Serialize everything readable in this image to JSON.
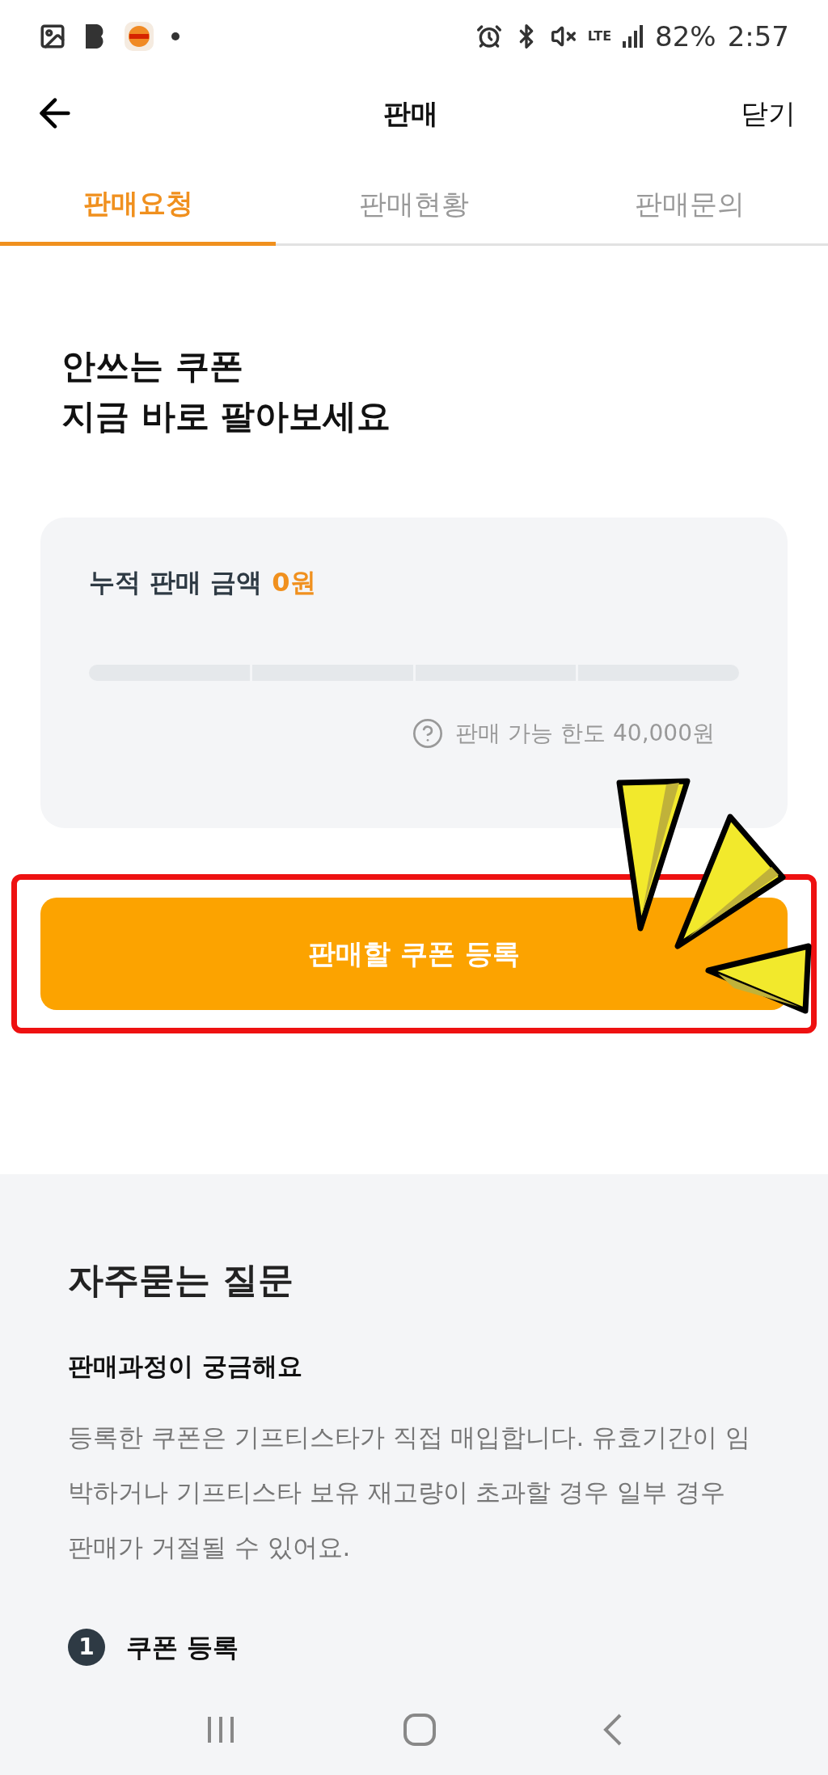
{
  "status_bar": {
    "time": "2:57",
    "battery": "82%",
    "network": "LTE"
  },
  "header": {
    "title": "판매",
    "close": "닫기"
  },
  "tabs": [
    {
      "label": "판매요청",
      "selected": true
    },
    {
      "label": "판매현황",
      "selected": false
    },
    {
      "label": "판매문의",
      "selected": false
    }
  ],
  "headline": [
    "안쓰는 쿠폰",
    "지금 바로 팔아보세요"
  ],
  "summary_card": {
    "label": "누적 판매 금액",
    "amount": "0원",
    "limit": "판매 가능 한도 40,000원"
  },
  "register_button": {
    "label": "판매할 쿠폰 등록",
    "highlighted": true
  },
  "faq": {
    "title": "자주묻는 질문",
    "question": "판매과정이 궁금해요",
    "answer": "등록한 쿠폰은 기프티스타가 직접 매입합니다. 유효기간이 임박하거나 기프티스타 보유 재고량이 초과할 경우 일부 경우 판매가 거절될 수 있어요.",
    "steps": [
      {
        "number": "1",
        "label": "쿠폰 등록"
      }
    ]
  }
}
